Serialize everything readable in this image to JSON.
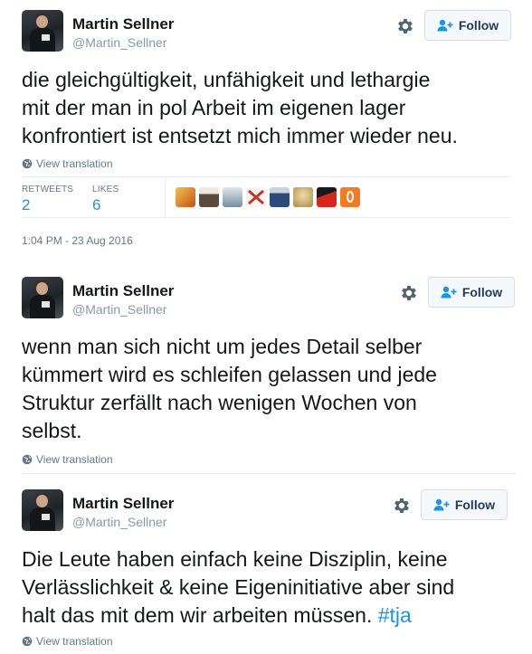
{
  "tweets": [
    {
      "name": "Martin Sellner",
      "handle": "@Martin_Sellner",
      "follow_label": "Follow",
      "lines": [
        "die gleichgültigkeit, unfähigkeit und lethargie",
        "mit der man in pol Arbeit im eigenen lager",
        "konfrontiert ist entsetzt mich immer wieder neu."
      ],
      "translate_label": "View translation",
      "stats": {
        "retweets_label": "RETWEETS",
        "retweets": "2",
        "likes_label": "LIKES",
        "likes": "6"
      },
      "timestamp": "1:04 PM - 23 Aug 2016"
    },
    {
      "name": "Martin Sellner",
      "handle": "@Martin_Sellner",
      "follow_label": "Follow",
      "lines": [
        "wenn man sich nicht um jedes Detail selber",
        "kümmert wird es schleifen gelassen und jede",
        "Struktur zerfällt nach wenigen Wochen von",
        "selbst."
      ],
      "translate_label": "View translation"
    },
    {
      "name": "Martin Sellner",
      "handle": "@Martin_Sellner",
      "follow_label": "Follow",
      "lines": [
        "Die Leute haben einfach keine Disziplin, keine",
        "Verlässlichkeit & keine Eigeninitiative aber sind",
        "halt das mit dem wir arbeiten müssen. "
      ],
      "hashtag": "#tja",
      "translate_label": "View translation"
    }
  ],
  "likers": [
    {
      "icon": "liker-avatar-1",
      "color": "#e07a1f"
    },
    {
      "icon": "liker-avatar-2",
      "color": "#6b5a4e"
    },
    {
      "icon": "liker-avatar-3",
      "color": "#8fa3b5"
    },
    {
      "icon": "liker-avatar-4",
      "color": "#c0392b"
    },
    {
      "icon": "liker-avatar-5",
      "color": "#2e4a7a"
    },
    {
      "icon": "liker-avatar-6",
      "color": "#c9a96a"
    },
    {
      "icon": "liker-avatar-7",
      "color": "#d6271f"
    },
    {
      "icon": "liker-avatar-8",
      "color": "#f07c28"
    }
  ],
  "colors": {
    "link_blue": "#1b95e0",
    "muted_gray": "#657786",
    "follow_text": "#1f3b57"
  }
}
